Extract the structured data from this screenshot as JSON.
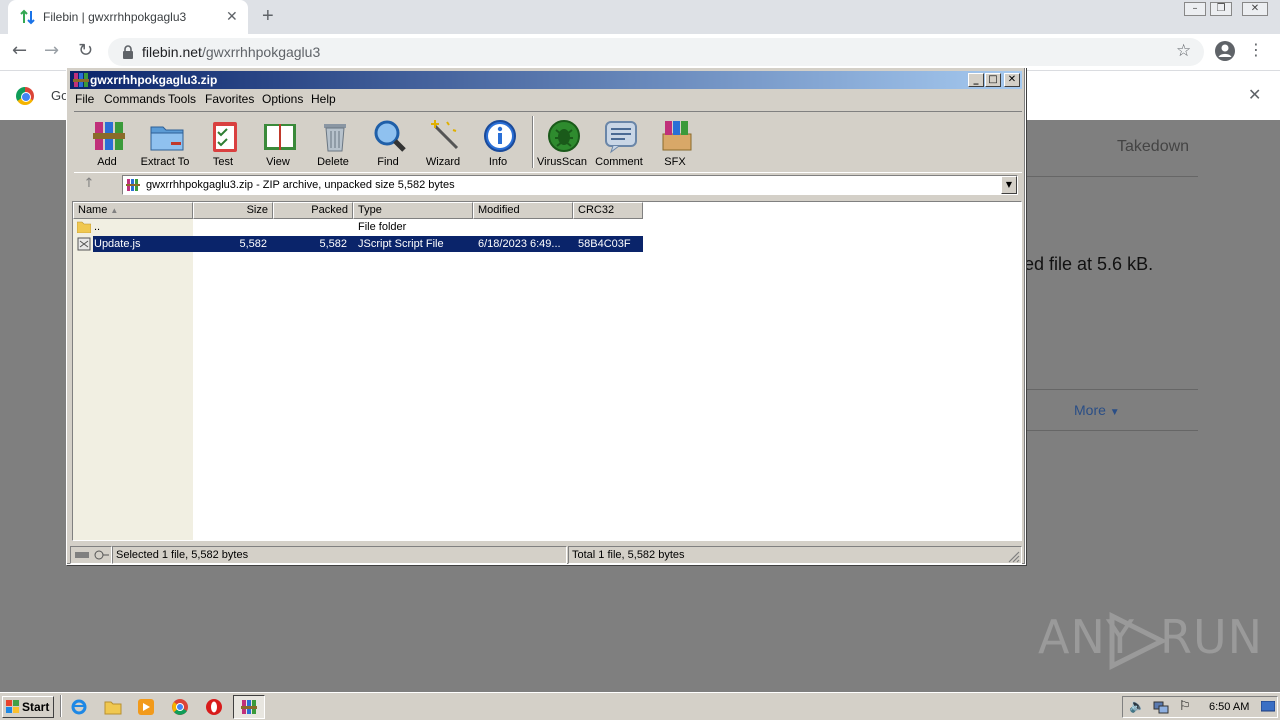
{
  "browser": {
    "tab_title": "Filebin | gwxrrhhpokgaglu3",
    "url_domain": "filebin.net",
    "url_path": "/gwxrrhhpokgaglu3",
    "infobar_text": "Go"
  },
  "page": {
    "takedown": "Takedown",
    "text_fragment": "ed file at 5.6 kB.",
    "more": "More"
  },
  "watermark": {
    "left": "ANY",
    "right": "RUN"
  },
  "winrar": {
    "title": "gwxrrhhpokgaglu3.zip",
    "menu": [
      "File",
      "Commands",
      "Tools",
      "Favorites",
      "Options",
      "Help"
    ],
    "toolbar": [
      {
        "label": "Add",
        "icon": "add-archive-icon"
      },
      {
        "label": "Extract To",
        "icon": "extract-folder-icon"
      },
      {
        "label": "Test",
        "icon": "test-clipboard-icon"
      },
      {
        "label": "View",
        "icon": "view-book-icon"
      },
      {
        "label": "Delete",
        "icon": "trash-can-icon"
      },
      {
        "label": "Find",
        "icon": "magnifier-icon"
      },
      {
        "label": "Wizard",
        "icon": "magic-wand-icon"
      },
      {
        "label": "Info",
        "icon": "info-icon"
      },
      {
        "label": "VirusScan",
        "icon": "virus-scan-icon"
      },
      {
        "label": "Comment",
        "icon": "comment-icon"
      },
      {
        "label": "SFX",
        "icon": "sfx-icon"
      }
    ],
    "path": "gwxrrhhpokgaglu3.zip - ZIP archive, unpacked size 5,582 bytes",
    "columns": [
      "Name",
      "Size",
      "Packed",
      "Type",
      "Modified",
      "CRC32"
    ],
    "rows": [
      {
        "name": "..",
        "size": "",
        "packed": "",
        "type": "File folder",
        "modified": "",
        "crc": ""
      },
      {
        "name": "Update.js",
        "size": "5,582",
        "packed": "5,582",
        "type": "JScript Script File",
        "modified": "6/18/2023 6:49...",
        "crc": "58B4C03F"
      }
    ],
    "status_left": "Selected 1 file, 5,582 bytes",
    "status_right": "Total 1 file, 5,582 bytes"
  },
  "taskbar": {
    "start": "Start",
    "clock": "6:50 AM"
  },
  "colors": {
    "title_active": "#0a246a",
    "selection": "#0a246a",
    "window_face": "#d4d0c8"
  }
}
